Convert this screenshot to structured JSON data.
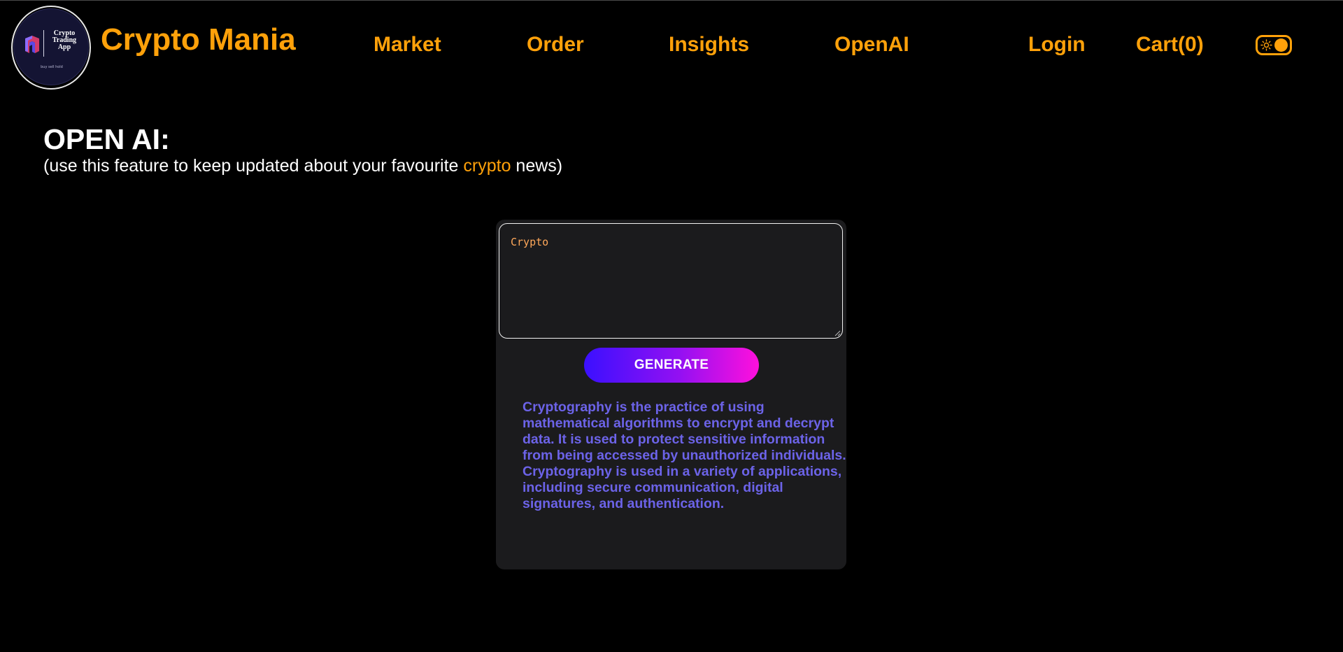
{
  "header": {
    "logo": {
      "title": "Crypto Trading App",
      "tagline": "buy sell hold"
    },
    "brand": "Crypto Mania",
    "nav": {
      "market": "Market",
      "order": "Order",
      "insights": "Insights",
      "openai": "OpenAI",
      "login": "Login",
      "cart": "Cart(0)"
    },
    "theme_toggle_icon": "sun-icon"
  },
  "page": {
    "title": "OPEN AI:",
    "subtitle_before": "(use this feature to keep updated about your favourite ",
    "subtitle_accent": "crypto",
    "subtitle_after": " news)"
  },
  "card": {
    "prompt_value": "Crypto",
    "generate_label": "GENERATE",
    "output": "Cryptography is the practice of using mathematical algorithms to encrypt and decrypt data. It is used to protect sensitive information from being accessed by unauthorized individuals. Cryptography is used in a variety of applications, including secure communication, digital signatures, and authentication."
  },
  "colors": {
    "accent": "#ffa10a",
    "background": "#000000",
    "card": "#1b1b1d",
    "output_text": "#6c63e8",
    "button_gradient_start": "#3b10ff",
    "button_gradient_end": "#ff10dc"
  }
}
